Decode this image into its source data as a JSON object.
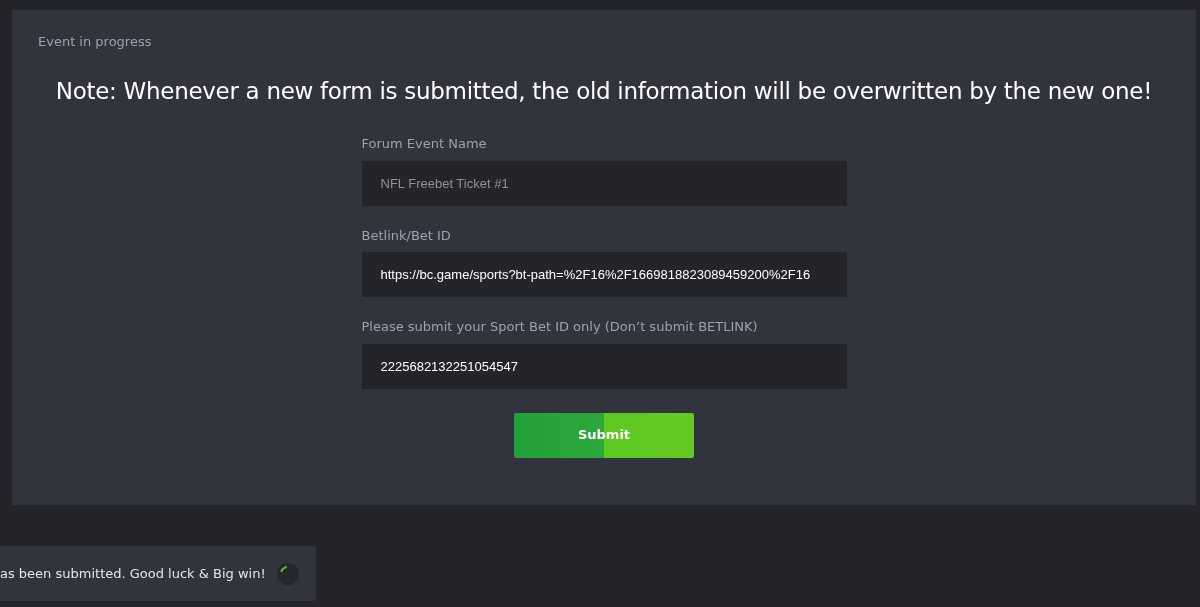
{
  "panel": {
    "title": "Event in progress",
    "note": "Note: Whenever a new form is submitted, the old information will be overwritten by the new one!"
  },
  "fields": [
    {
      "label": "Forum Event Name",
      "placeholder": "NFL Freebet Ticket #1"
    },
    {
      "label": "Betlink/Bet ID",
      "value": "https://bc.game/sports?bt-path=%2F16%2F1669818823089459200%2F16"
    },
    {
      "label": "Please submit your Sport Bet ID only (Don’t submit BETLINK)",
      "value": "2225682132251054547"
    }
  ],
  "submit_button": "Submit",
  "toast": {
    "message": "as been submitted. Good luck & Big win!"
  }
}
